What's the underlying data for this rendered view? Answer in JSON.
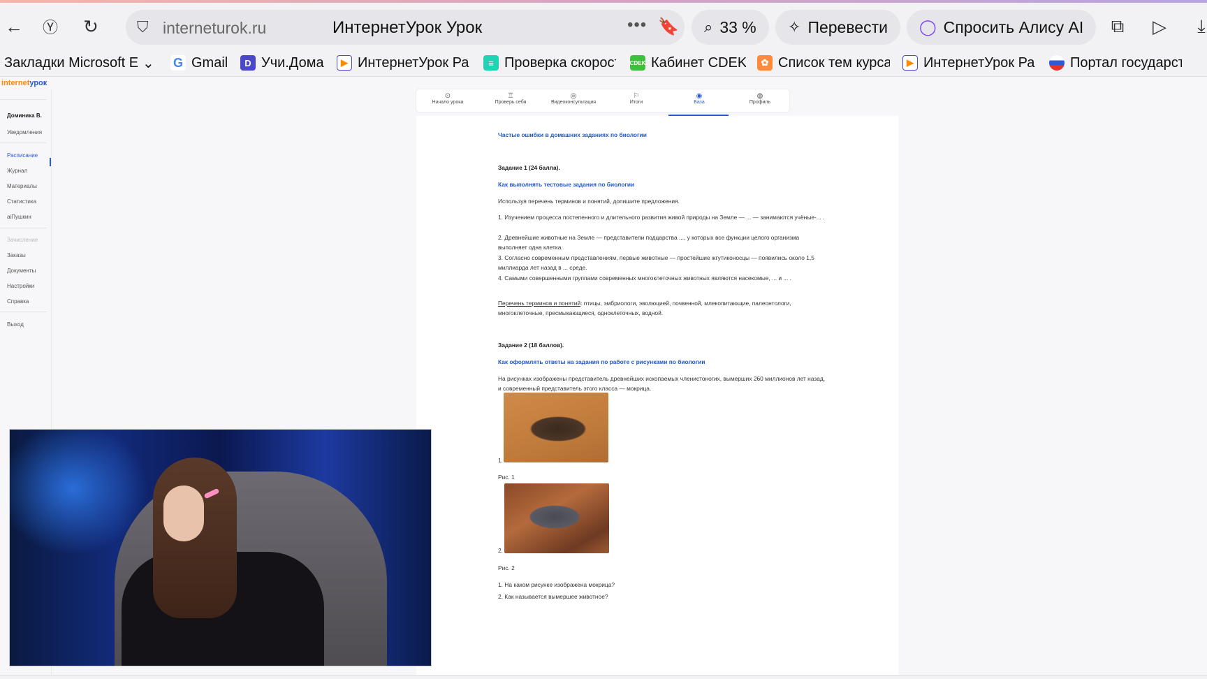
{
  "browser": {
    "url_host": "interneturok.ru",
    "page_title": "ИнтернетУрок Урок",
    "zoom": "33 %",
    "translate_label": "Перевести",
    "alice_label": "Спросить Алису AI"
  },
  "bookmarks": [
    {
      "label": "Закладки Microsoft E",
      "icon": "folder-icon"
    },
    {
      "label": "Gmail",
      "icon": "google-icon"
    },
    {
      "label": "Учи.Дома",
      "icon": "uchi-icon"
    },
    {
      "label": "ИнтернетУрок Ра",
      "icon": "interneturok-icon"
    },
    {
      "label": "Проверка скорост",
      "icon": "speedtest-icon"
    },
    {
      "label": "Кабинет CDEK",
      "icon": "cdek-icon"
    },
    {
      "label": "Список тем курса",
      "icon": "course-icon"
    },
    {
      "label": "ИнтернетУрок Ра",
      "icon": "interneturok-icon"
    },
    {
      "label": "Портал государст",
      "icon": "gosuslugi-icon"
    }
  ],
  "site": {
    "logo_a": "internet",
    "logo_b": "урок",
    "sidebar": {
      "user": "Доминика В.",
      "notifications": "Уведомления",
      "schedule": "Расписание",
      "journal": "Журнал",
      "materials": "Материалы",
      "stats": "Статистика",
      "aipushkin": "аiПушкин",
      "enroll": "Зачисление",
      "orders": "Заказы",
      "documents": "Документы",
      "settings": "Настройки",
      "help": "Справка",
      "logout": "Выход"
    },
    "tabs": [
      "Начало урока",
      "Проверь себя",
      "Видеоконсультация",
      "Итоги",
      "База",
      "Профиль"
    ]
  },
  "content": {
    "header_link": "Частые ошибки в домашних заданиях по биологии",
    "task1_title": "Задание 1 (24 балла).",
    "task1_link": "Как выполнять тестовые задания по биологии",
    "task1_intro": "Используя перечень терминов и понятий, допишите предложения.",
    "task1_items": [
      "1. Изучением процесса постепенного и длительного развития живой природы на Земле — ... — занимаются учёные-... .",
      "2. Древнейшие животные на Земле — представители подцарства ..., у которых все функции целого организма выполняет одна клетка.",
      "3. Согласно современным представлениям, первые животные — простейшие жгутиконосцы — появились около 1,5 миллиарда лет назад в ... среде.",
      "4. Самыми совершенными группами современных многоклеточных животных являются насекомые, ... и ... ."
    ],
    "terms_label": "Перечень терминов и понятий",
    "terms_text": ": птицы, эмбриологи, эволюцией, почвенной, млекопитающие, палеонтологи, многоклеточные, пресмыкающиеся, одноклеточных, водной.",
    "task2_title": "Задание 2 (18 баллов).",
    "task2_link": "Как оформлять ответы на задания по работе с рисунками по биологии",
    "task2_intro": "На рисунках изображены представитель древнейших ископаемых членистоногих, вымерших 260 миллионов лет назад, и современный представитель этого класса — мокрица.",
    "img1_num": "1.",
    "fig1": "Рис. 1",
    "img2_num": "2.",
    "fig2": "Рис. 2",
    "q1": "1. На каком рисунке изображена мокрица?",
    "q2": "2. Как называется вымершее животное?"
  }
}
